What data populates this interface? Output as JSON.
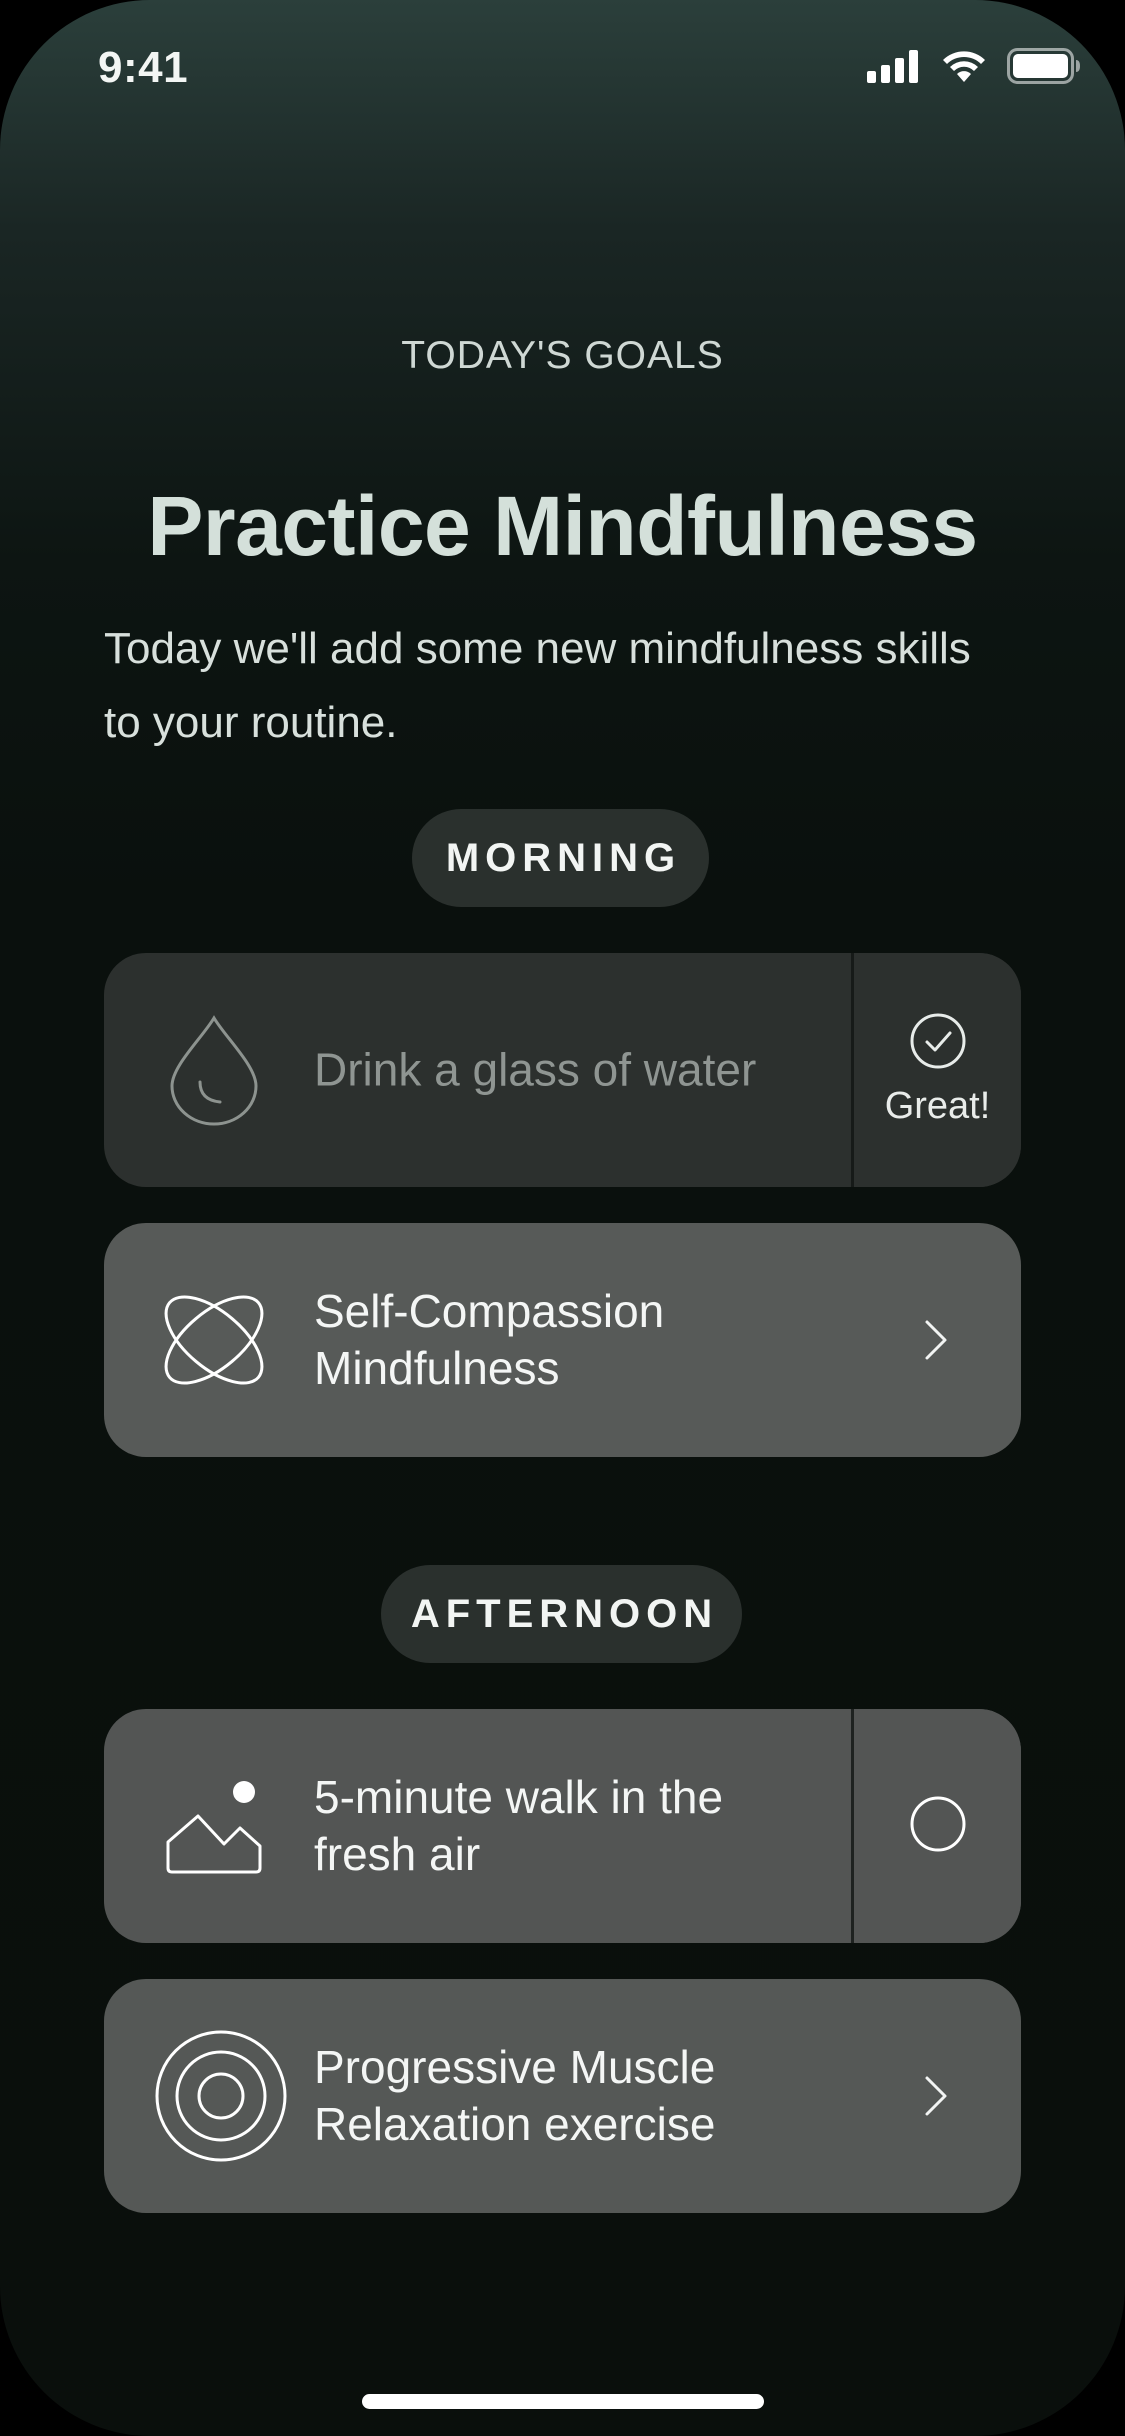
{
  "status_bar": {
    "time": "9:41",
    "icons": [
      "cellular-signal-icon",
      "wifi-icon",
      "battery-icon"
    ]
  },
  "header": {
    "eyebrow": "TODAY'S GOALS",
    "title": "Practice Mindfulness",
    "subtitle": "Today we'll add some new mindfulness skills to your routine."
  },
  "sections": [
    {
      "label": "MORNING",
      "items": [
        {
          "icon": "water-drop-icon",
          "text": "Drink a glass of water",
          "type": "checklist",
          "completed": true,
          "status_text": "Great!"
        },
        {
          "icon": "atom-orbit-icon",
          "text": "Self-Compassion Mindfulness",
          "type": "link"
        }
      ]
    },
    {
      "label": "AFTERNOON",
      "items": [
        {
          "icon": "mountain-sun-icon",
          "text": "5-minute walk in the fresh air",
          "type": "checklist",
          "completed": false
        },
        {
          "icon": "concentric-circles-icon",
          "text": "Progressive Muscle Relaxation exercise",
          "type": "link"
        }
      ]
    }
  ],
  "colors": {
    "background_top": "#2b3f3b",
    "background_bottom": "#0a0f0c",
    "title": "#d4e0da",
    "pill_background": "#2a302d",
    "card_completed": "#2c302e",
    "card_default": "#575a58"
  }
}
